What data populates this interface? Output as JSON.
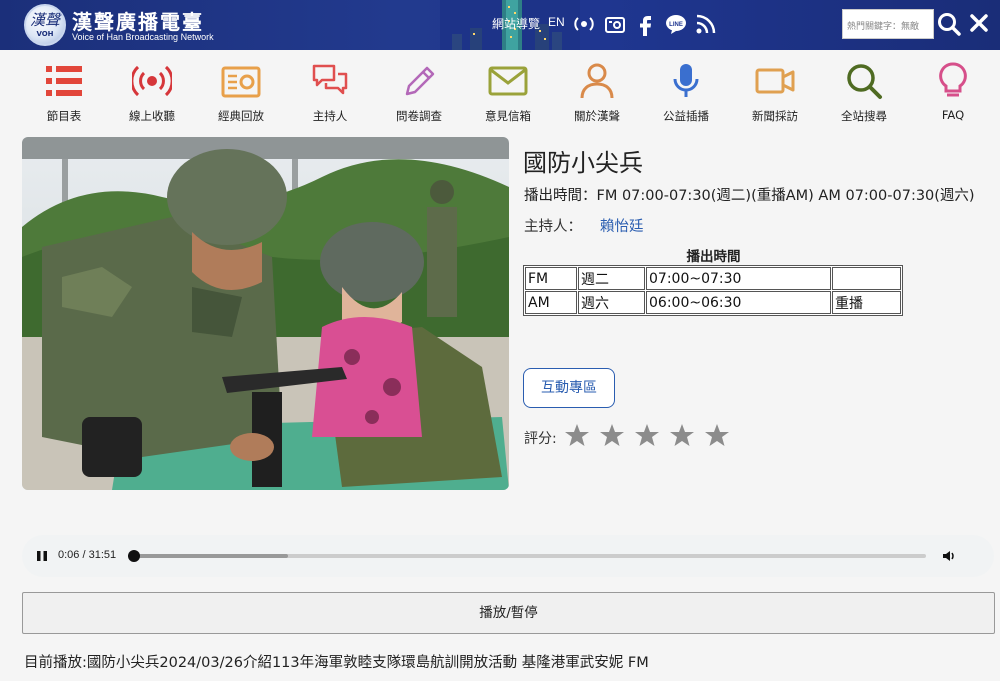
{
  "header": {
    "site_title": "漢聲廣播電臺",
    "site_subtitle": "Voice of Han Broadcasting Network",
    "logo_text": "VOH",
    "logo_char": "漢聲",
    "nav_guide": "網站導覽",
    "nav_en": "EN",
    "search_placeholder": "熱門關鍵字：無敵",
    "icons": [
      "radio-wave-icon",
      "radio-icon",
      "facebook-icon",
      "line-icon",
      "rss-icon"
    ],
    "brand_color": "#1f3690"
  },
  "menu": {
    "items": [
      {
        "label": "節目表",
        "icon": "list-icon",
        "color": "#e2463a"
      },
      {
        "label": "線上收聽",
        "icon": "broadcast-icon",
        "color": "#d6363a"
      },
      {
        "label": "經典回放",
        "icon": "radio-replay-icon",
        "color": "#e8a04a"
      },
      {
        "label": "主持人",
        "icon": "chat-bubbles-icon",
        "color": "#e04f4f"
      },
      {
        "label": "問卷調查",
        "icon": "pencil-icon",
        "color": "#b368b8"
      },
      {
        "label": "意見信箱",
        "icon": "mail-icon",
        "color": "#9aa23a"
      },
      {
        "label": "關於漢聲",
        "icon": "person-icon",
        "color": "#d98a4a"
      },
      {
        "label": "公益插播",
        "icon": "microphone-icon",
        "color": "#3a6fcf"
      },
      {
        "label": "新聞採訪",
        "icon": "video-camera-icon",
        "color": "#e0a050"
      },
      {
        "label": "全站搜尋",
        "icon": "search-icon",
        "color": "#4f6b22"
      },
      {
        "label": "FAQ",
        "icon": "lightbulb-icon",
        "color": "#d64f8a"
      }
    ]
  },
  "program": {
    "title": "國防小尖兵",
    "air_time": "播出時間：FM 07:00-07:30(週二)(重播AM)  AM 07:00-07:30(週六)",
    "host_label": "主持人：",
    "host_name": "賴怡廷",
    "table_caption": "播出時間",
    "schedule": [
      [
        "FM",
        "週二",
        "07:00~07:30",
        ""
      ],
      [
        "AM",
        "週六",
        "06:00~06:30",
        "重播"
      ]
    ],
    "interact_label": "互動專區",
    "rating_label": "評分:",
    "rating": 0,
    "star_count": 5
  },
  "player": {
    "time": "0:06 / 31:51",
    "progress": 0.003,
    "buffered": 0.2
  },
  "play_pause_label": "播放/暫停",
  "now_playing": "目前播放:國防小尖兵2024/03/26介紹113年海軍敦睦支隊環島航訓開放活動 基隆港軍武安妮 FM"
}
